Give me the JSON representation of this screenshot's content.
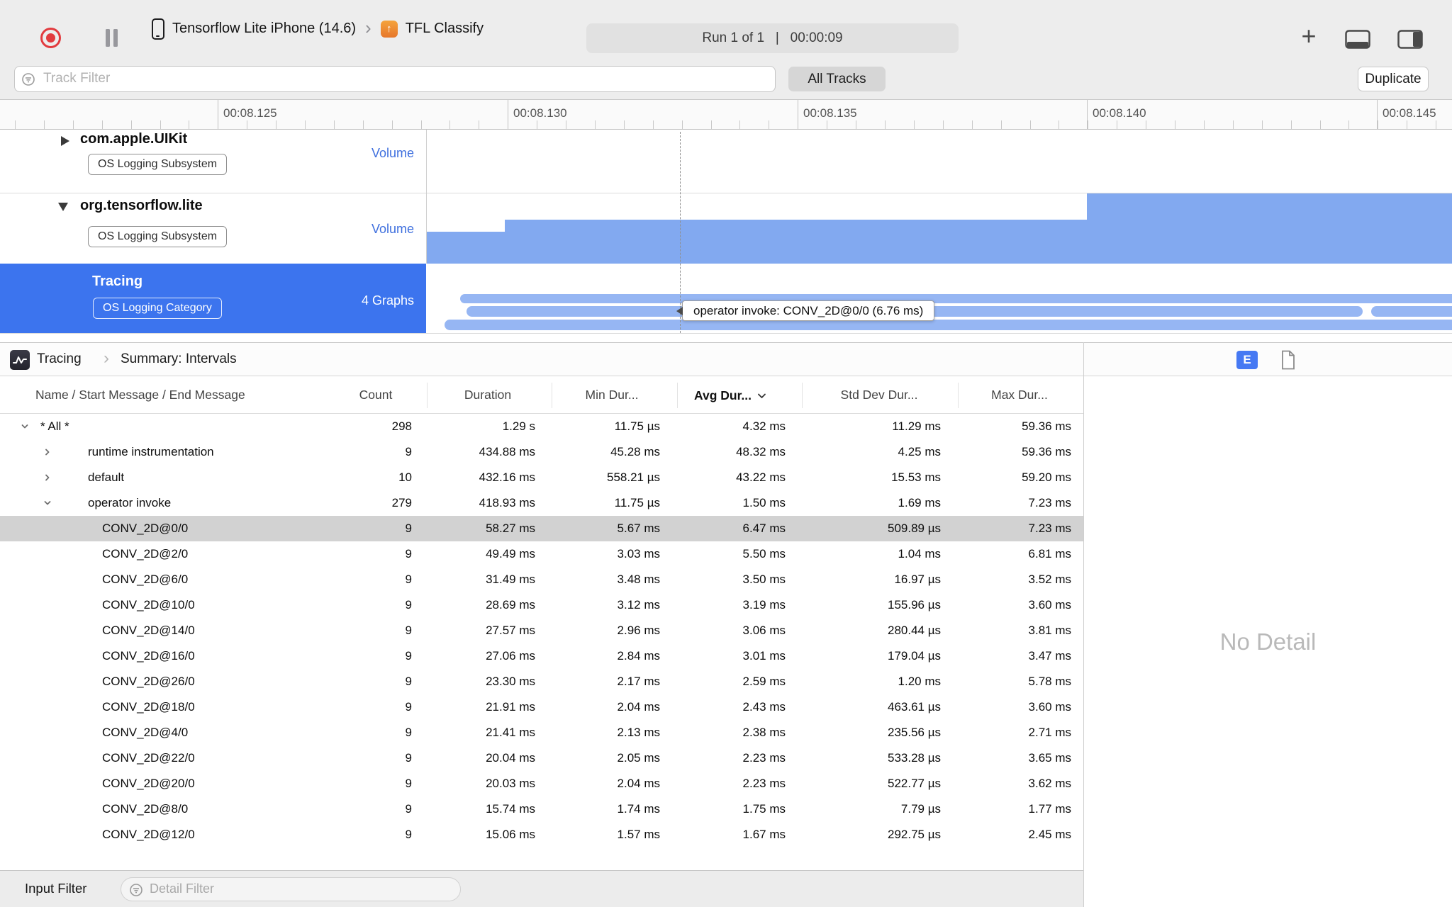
{
  "colors": {
    "accent_blue": "#3C74EE",
    "bar_blue": "#82A9F0",
    "capsule_blue": "#96B6F3",
    "selection_gray": "#D2D2D2",
    "volume_label_blue": "#3E6FDE",
    "record_red": "#E23B3F",
    "e_button_blue": "#4679F3"
  },
  "toolbar": {
    "device_name": "Tensorflow Lite iPhone (14.6)",
    "target_name": "TFL Classify",
    "run_display": "Run 1 of 1   |   00:00:09",
    "add_label": "+"
  },
  "filter_bar": {
    "track_filter_placeholder": "Track Filter",
    "all_tracks_label": "All Tracks",
    "duplicate_label": "Duplicate"
  },
  "ruler": {
    "labels": [
      "00:08.125",
      "00:08.130",
      "00:08.135",
      "00:08.140",
      "00:08.145"
    ]
  },
  "tracks": [
    {
      "name": "com.apple.UIKit",
      "badge": "OS Logging Subsystem",
      "meta": "Volume",
      "state": "collapsed",
      "selected": false
    },
    {
      "name": "org.tensorflow.lite",
      "badge": "OS Logging Subsystem",
      "meta": "Volume",
      "state": "expanded",
      "selected": false
    },
    {
      "name": "Tracing",
      "badge": "OS Logging Category",
      "meta": "4 Graphs",
      "state": "expanded",
      "selected": true
    }
  ],
  "timeline": {
    "tooltip": "operator invoke: CONV_2D@0/0 (6.76 ms)"
  },
  "detail": {
    "breadcrumb": [
      "Tracing",
      "Summary: Intervals"
    ],
    "e_button_label": "E",
    "no_detail_label": "No Detail",
    "columns": [
      "Name / Start Message / End Message",
      "Count",
      "Duration",
      "Min Dur...",
      "Avg Dur...",
      "Std Dev Dur...",
      "Max Dur..."
    ],
    "sorted_column": "Avg Dur...",
    "rows": [
      {
        "name": "* All *",
        "level": 0,
        "disclosure": "down",
        "selected": false,
        "values": [
          "298",
          "1.29 s",
          "11.75 µs",
          "4.32 ms",
          "11.29 ms",
          "59.36 ms"
        ]
      },
      {
        "name": "runtime instrumentation",
        "level": 1,
        "disclosure": "right",
        "selected": false,
        "values": [
          "9",
          "434.88 ms",
          "45.28 ms",
          "48.32 ms",
          "4.25 ms",
          "59.36 ms"
        ]
      },
      {
        "name": "default",
        "level": 1,
        "disclosure": "right",
        "selected": false,
        "values": [
          "10",
          "432.16 ms",
          "558.21 µs",
          "43.22 ms",
          "15.53 ms",
          "59.20 ms"
        ]
      },
      {
        "name": "operator invoke",
        "level": 1,
        "disclosure": "down",
        "selected": false,
        "values": [
          "279",
          "418.93 ms",
          "11.75 µs",
          "1.50 ms",
          "1.69 ms",
          "7.23 ms"
        ]
      },
      {
        "name": "CONV_2D@0/0",
        "level": 2,
        "disclosure": null,
        "selected": true,
        "values": [
          "9",
          "58.27 ms",
          "5.67 ms",
          "6.47 ms",
          "509.89 µs",
          "7.23 ms"
        ]
      },
      {
        "name": "CONV_2D@2/0",
        "level": 2,
        "disclosure": null,
        "selected": false,
        "values": [
          "9",
          "49.49 ms",
          "3.03 ms",
          "5.50 ms",
          "1.04 ms",
          "6.81 ms"
        ]
      },
      {
        "name": "CONV_2D@6/0",
        "level": 2,
        "disclosure": null,
        "selected": false,
        "values": [
          "9",
          "31.49 ms",
          "3.48 ms",
          "3.50 ms",
          "16.97 µs",
          "3.52 ms"
        ]
      },
      {
        "name": "CONV_2D@10/0",
        "level": 2,
        "disclosure": null,
        "selected": false,
        "values": [
          "9",
          "28.69 ms",
          "3.12 ms",
          "3.19 ms",
          "155.96 µs",
          "3.60 ms"
        ]
      },
      {
        "name": "CONV_2D@14/0",
        "level": 2,
        "disclosure": null,
        "selected": false,
        "values": [
          "9",
          "27.57 ms",
          "2.96 ms",
          "3.06 ms",
          "280.44 µs",
          "3.81 ms"
        ]
      },
      {
        "name": "CONV_2D@16/0",
        "level": 2,
        "disclosure": null,
        "selected": false,
        "values": [
          "9",
          "27.06 ms",
          "2.84 ms",
          "3.01 ms",
          "179.04 µs",
          "3.47 ms"
        ]
      },
      {
        "name": "CONV_2D@26/0",
        "level": 2,
        "disclosure": null,
        "selected": false,
        "values": [
          "9",
          "23.30 ms",
          "2.17 ms",
          "2.59 ms",
          "1.20 ms",
          "5.78 ms"
        ]
      },
      {
        "name": "CONV_2D@18/0",
        "level": 2,
        "disclosure": null,
        "selected": false,
        "values": [
          "9",
          "21.91 ms",
          "2.04 ms",
          "2.43 ms",
          "463.61 µs",
          "3.60 ms"
        ]
      },
      {
        "name": "CONV_2D@4/0",
        "level": 2,
        "disclosure": null,
        "selected": false,
        "values": [
          "9",
          "21.41 ms",
          "2.13 ms",
          "2.38 ms",
          "235.56 µs",
          "2.71 ms"
        ]
      },
      {
        "name": "CONV_2D@22/0",
        "level": 2,
        "disclosure": null,
        "selected": false,
        "values": [
          "9",
          "20.04 ms",
          "2.05 ms",
          "2.23 ms",
          "533.28 µs",
          "3.65 ms"
        ]
      },
      {
        "name": "CONV_2D@20/0",
        "level": 2,
        "disclosure": null,
        "selected": false,
        "values": [
          "9",
          "20.03 ms",
          "2.04 ms",
          "2.23 ms",
          "522.77 µs",
          "3.62 ms"
        ]
      },
      {
        "name": "CONV_2D@8/0",
        "level": 2,
        "disclosure": null,
        "selected": false,
        "values": [
          "9",
          "15.74 ms",
          "1.74 ms",
          "1.75 ms",
          "7.79 µs",
          "1.77 ms"
        ]
      },
      {
        "name": "CONV_2D@12/0",
        "level": 2,
        "disclosure": null,
        "selected": false,
        "values": [
          "9",
          "15.06 ms",
          "1.57 ms",
          "1.67 ms",
          "292.75 µs",
          "2.45 ms"
        ]
      }
    ]
  },
  "bottom_bar": {
    "input_filter_label": "Input Filter",
    "detail_filter_placeholder": "Detail Filter"
  }
}
